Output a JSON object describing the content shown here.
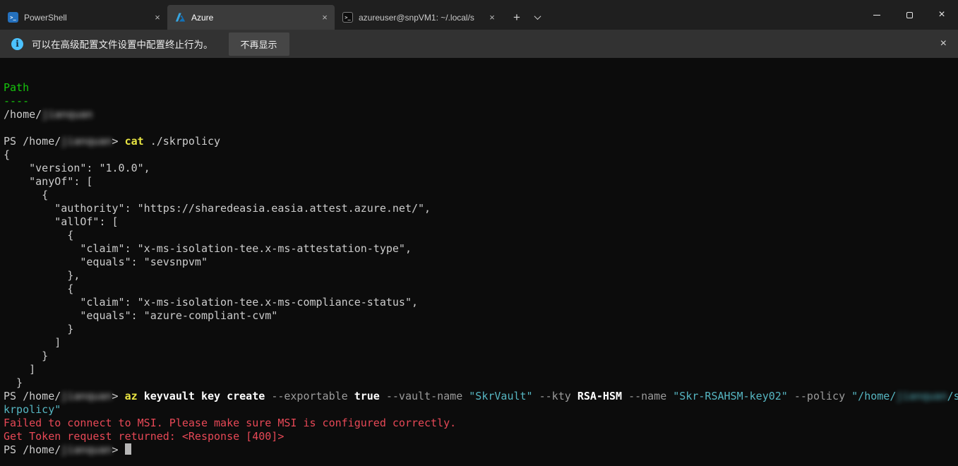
{
  "window": {
    "tabs": [
      {
        "title": "PowerShell",
        "icon_glyph": ">_"
      },
      {
        "title": "Azure"
      },
      {
        "title": "azureuser@snpVM1: ~/.local/s",
        "icon_glyph": ">_"
      }
    ],
    "new_tab_glyph": "+",
    "tab_close_glyph": "×",
    "controls": {
      "close_glyph": "×"
    }
  },
  "notification": {
    "info_glyph": "i",
    "text": "可以在高级配置文件设置中配置终止行为。",
    "dismiss_button": "不再显示",
    "close_glyph": "×"
  },
  "colors": {
    "titlebar_bg": "#1f1f1f",
    "active_tab_bg": "#3b3b3b",
    "notification_bg": "#323232",
    "terminal_bg": "#0c0c0c",
    "foreground": "#cccccc",
    "green": "#16c60c",
    "yellow": "#e9e543",
    "cyan": "#56b6c2",
    "red": "#e74856",
    "gray": "#9b9b9b",
    "bright": "#ffffff",
    "accent_blue": "#4cc2ff"
  },
  "terminal": {
    "lines": [
      {
        "segments": [
          {
            "t": "Path",
            "c": "green"
          }
        ]
      },
      {
        "segments": [
          {
            "t": "----",
            "c": "green"
          }
        ]
      },
      {
        "segments": [
          {
            "t": "/home/",
            "c": "fg"
          },
          {
            "t": "jianquan",
            "c": "fg",
            "blur": true
          }
        ]
      },
      {
        "segments": []
      },
      {
        "segments": [
          {
            "t": "PS /home/",
            "c": "fg"
          },
          {
            "t": "jianquan",
            "c": "fg",
            "blur": true
          },
          {
            "t": "> ",
            "c": "fg"
          },
          {
            "t": "cat",
            "c": "yellow",
            "b": true
          },
          {
            "t": " ./skrpolicy",
            "c": "fg"
          }
        ]
      },
      {
        "segments": [
          {
            "t": "{",
            "c": "fg"
          }
        ]
      },
      {
        "segments": [
          {
            "t": "    \"version\": \"1.0.0\",",
            "c": "fg"
          }
        ]
      },
      {
        "segments": [
          {
            "t": "    \"anyOf\": [",
            "c": "fg"
          }
        ]
      },
      {
        "segments": [
          {
            "t": "      {",
            "c": "fg"
          }
        ]
      },
      {
        "segments": [
          {
            "t": "        \"authority\": \"https://sharedeasia.easia.attest.azure.net/\",",
            "c": "fg"
          }
        ]
      },
      {
        "segments": [
          {
            "t": "        \"allOf\": [",
            "c": "fg"
          }
        ]
      },
      {
        "segments": [
          {
            "t": "          {",
            "c": "fg"
          }
        ]
      },
      {
        "segments": [
          {
            "t": "            \"claim\": \"x-ms-isolation-tee.x-ms-attestation-type\",",
            "c": "fg"
          }
        ]
      },
      {
        "segments": [
          {
            "t": "            \"equals\": \"sevsnpvm\"",
            "c": "fg"
          }
        ]
      },
      {
        "segments": [
          {
            "t": "          },",
            "c": "fg"
          }
        ]
      },
      {
        "segments": [
          {
            "t": "          {",
            "c": "fg"
          }
        ]
      },
      {
        "segments": [
          {
            "t": "            \"claim\": \"x-ms-isolation-tee.x-ms-compliance-status\",",
            "c": "fg"
          }
        ]
      },
      {
        "segments": [
          {
            "t": "            \"equals\": \"azure-compliant-cvm\"",
            "c": "fg"
          }
        ]
      },
      {
        "segments": [
          {
            "t": "          }",
            "c": "fg"
          }
        ]
      },
      {
        "segments": [
          {
            "t": "        ]",
            "c": "fg"
          }
        ]
      },
      {
        "segments": [
          {
            "t": "      }",
            "c": "fg"
          }
        ]
      },
      {
        "segments": [
          {
            "t": "    ]",
            "c": "fg"
          }
        ]
      },
      {
        "segments": [
          {
            "t": "  }",
            "c": "fg"
          }
        ]
      },
      {
        "segments": [
          {
            "t": "PS /home/",
            "c": "fg"
          },
          {
            "t": "jianquan",
            "c": "fg",
            "blur": true
          },
          {
            "t": "> ",
            "c": "fg"
          },
          {
            "t": "az",
            "c": "yellow",
            "b": true
          },
          {
            "t": " ",
            "c": "fg"
          },
          {
            "t": "keyvault key create",
            "c": "bright"
          },
          {
            "t": " ",
            "c": "fg"
          },
          {
            "t": "--exportable",
            "c": "gray"
          },
          {
            "t": " ",
            "c": "fg"
          },
          {
            "t": "true",
            "c": "bright"
          },
          {
            "t": " ",
            "c": "fg"
          },
          {
            "t": "--vault-name",
            "c": "gray"
          },
          {
            "t": " ",
            "c": "fg"
          },
          {
            "t": "\"SkrVault\"",
            "c": "cyan"
          },
          {
            "t": " ",
            "c": "fg"
          },
          {
            "t": "--kty",
            "c": "gray"
          },
          {
            "t": " ",
            "c": "fg"
          },
          {
            "t": "RSA-HSM",
            "c": "bright"
          },
          {
            "t": " ",
            "c": "fg"
          },
          {
            "t": "--name",
            "c": "gray"
          },
          {
            "t": " ",
            "c": "fg"
          },
          {
            "t": "\"Skr-RSAHSM-key02\"",
            "c": "cyan"
          },
          {
            "t": " ",
            "c": "fg"
          },
          {
            "t": "--policy",
            "c": "gray"
          },
          {
            "t": " ",
            "c": "fg"
          },
          {
            "t": "\"/home/",
            "c": "cyan"
          },
          {
            "t": "jianquan",
            "c": "cyan",
            "blur": true
          },
          {
            "t": "/s",
            "c": "cyan"
          }
        ]
      },
      {
        "segments": [
          {
            "t": "krpolicy\"",
            "c": "cyan"
          }
        ]
      },
      {
        "segments": [
          {
            "t": "Failed to connect to MSI. Please make sure MSI is configured correctly.",
            "c": "red"
          }
        ]
      },
      {
        "segments": [
          {
            "t": "Get Token request returned: <Response [400]>",
            "c": "red"
          }
        ]
      },
      {
        "segments": [
          {
            "t": "PS /home/",
            "c": "fg"
          },
          {
            "t": "jianquan",
            "c": "fg",
            "blur": true
          },
          {
            "t": "> ",
            "c": "fg"
          }
        ],
        "cursor": true
      }
    ]
  }
}
